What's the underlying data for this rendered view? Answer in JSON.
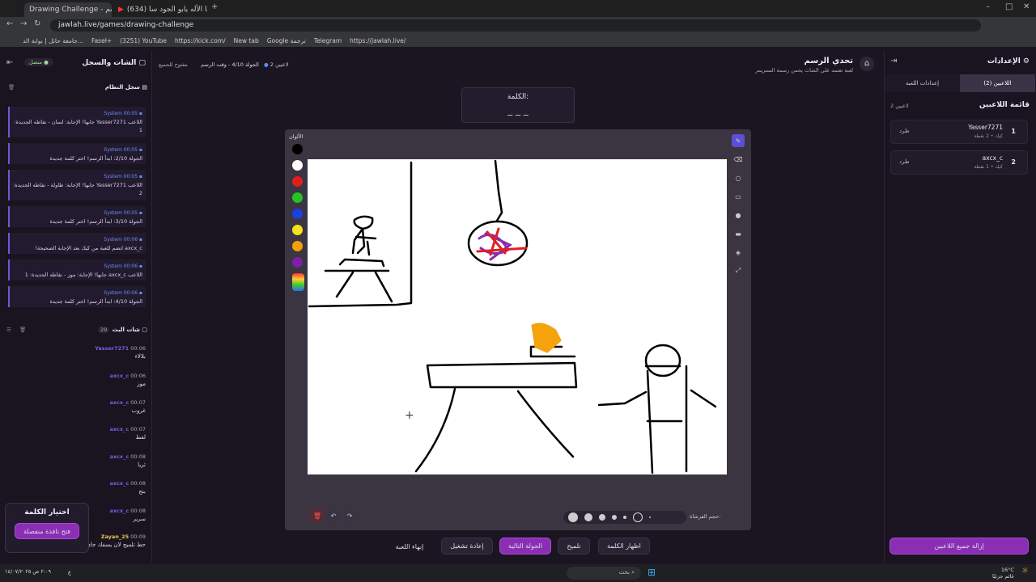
{
  "browser": {
    "tabs": [
      {
        "title": "Drawing Challenge - تحدي الرسم"
      },
      {
        "title": "(634) حنا طلبنا الأله يابو الجود سا..."
      }
    ],
    "url": "jawlah.live/games/drawing-challenge",
    "bookmarks": [
      "جامعة حائل | بوابة الد...",
      "Faseł+",
      "(3251) YouTube",
      "https://kick.com/",
      "New tab",
      "Google ترجمة",
      "Telegram",
      "https://jawlah.live/"
    ]
  },
  "header": {
    "title": "تحدي الرسم",
    "subtitle": "لعبة تعتمد على الشات يخمن رسمة الستريمر",
    "players_badge": "2 لاعبين",
    "round_info": "الجولة 4/10 - وقت الرسم",
    "open_label": "مفتوح للجميع"
  },
  "left": {
    "title": "الشات والسجل",
    "status": "متصل",
    "system_log": {
      "title": "سجل النظام",
      "count": "",
      "messages": [
        {
          "sender": "System",
          "time": "00:05",
          "text": "اللاعب Yasser7271 جابها! الإجابة: لسان - نقاطه الجديدة: 1"
        },
        {
          "sender": "System",
          "time": "00:05",
          "text": "الجولة 2/10: ابدأ الرسم! اختر كلمة جديدة"
        },
        {
          "sender": "System",
          "time": "00:05",
          "text": "اللاعب Yasser7271 جابها! الإجابة: طاولة - نقاطه الجديدة: 2"
        },
        {
          "sender": "System",
          "time": "00:05",
          "text": "الجولة 3/10: ابدأ الرسم! اختر كلمة جديدة"
        },
        {
          "sender": "System",
          "time": "00:06",
          "text": "axcx_c انضم للعبة من كيك بعد الإجابة الصحيحة!"
        },
        {
          "sender": "System",
          "time": "00:06",
          "text": "اللاعب axcx_c جابها! الإجابة: موز - نقاطه الجديدة: 1"
        },
        {
          "sender": "System",
          "time": "00:06",
          "text": "الجولة 4/10: ابدأ الرسم! اختر كلمة جديدة"
        }
      ]
    },
    "chat": {
      "title": "شات البث",
      "count": "29",
      "messages": [
        {
          "user": "Yasser7271",
          "time": "00:06",
          "text": "بلالاء"
        },
        {
          "user": "axcx_c",
          "time": "00:06",
          "text": "موز"
        },
        {
          "user": "axcx_c",
          "time": "00:07",
          "text": "غروب"
        },
        {
          "user": "axcx_c",
          "time": "00:07",
          "text": "لقط"
        },
        {
          "user": "axcx_c",
          "time": "00:08",
          "text": "ثريا"
        },
        {
          "user": "axcx_c",
          "time": "00:08",
          "text": "بنج"
        },
        {
          "user": "axcx_c",
          "time": "00:08",
          "text": "سرير"
        },
        {
          "user": "Zayan_25",
          "time": "00:09",
          "text": "حط تلميح لان يسفك جاي"
        }
      ]
    },
    "word_pick": {
      "title": "اختيار الكلمة",
      "button": "فتح نافذة منفصلة"
    }
  },
  "center": {
    "word_label": "الكلمة:",
    "word_mask": "_ _ _",
    "colors_label": "الألوان",
    "brush_label": "حجم الفرشاة:",
    "colors": [
      "#000000",
      "#ffffff",
      "#e11d1d",
      "#22c322",
      "#1c3fe0",
      "#f5e11a",
      "#f59e0b",
      "#7e1fa8"
    ],
    "actions": {
      "end": "إنهاء اللعبة",
      "restart": "إعادة تشغيل",
      "next": "الجولة التالية",
      "hint": "تلميح",
      "reveal": "اظهار الكلمة"
    }
  },
  "right": {
    "title": "الإعدادات",
    "tabs": {
      "players": "اللاعبين (2)",
      "settings": "إعدادات اللعبة"
    },
    "list_title": "قائمة اللاعبين",
    "count": "2 لاعبين",
    "players": [
      {
        "rank": "1",
        "name": "Yasser7271",
        "meta": "كيك • 2 نقطة",
        "kick": "طرد"
      },
      {
        "rank": "2",
        "name": "axcx_c",
        "meta": "كيك • 1 نقطة",
        "kick": "طرد"
      }
    ],
    "remove_all": "إزالة جميع اللاعبين"
  },
  "taskbar": {
    "search": "بحث",
    "weather": "16°C",
    "weather_sub": "غائم جزئيًا",
    "time": "٢:٠٩ ص",
    "date": "١٤/٠٧/٢٠٢٥",
    "lang": "ع"
  }
}
